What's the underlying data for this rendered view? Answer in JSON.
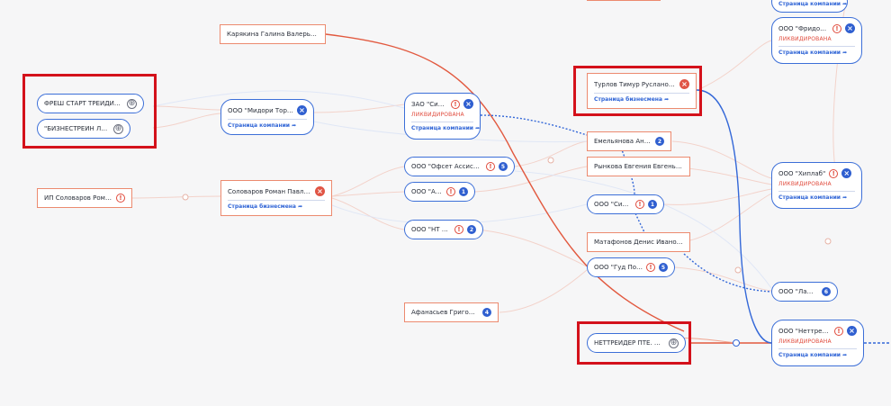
{
  "nodes": {
    "fresh_start": {
      "label": "ФРЕШ СТАРТ ТРЕЙДИНГ...",
      "icon": "globe-icon"
    },
    "biznestrain": {
      "label": "\"БИЗНЕСТРЕЙН ЛТД\"",
      "icon": "globe-icon"
    },
    "ip_solovarov": {
      "label": "ИП Соловаров Роман..."
    },
    "karyakina": {
      "label": "Карякина Галина Валерьевна"
    },
    "midori": {
      "label": "ООО \"Мидори Торедо\"",
      "link": "Страница компании"
    },
    "solovarov": {
      "label": "Соловаров Роман Павлович",
      "link": "Страница бизнесмена"
    },
    "zao_sigma": {
      "label": "ЗАО \"Сигма\"",
      "status": "ЛИКВИДИРОВАНА",
      "link": "Страница компании"
    },
    "offset": {
      "label": "ООО \"Офсет Ассистанс\"",
      "badge": "5"
    },
    "ak": {
      "label": "ООО \"АК -...",
      "badge": "1"
    },
    "nt_oil": {
      "label": "ООО \"НТ Ойл\"",
      "badge": "2"
    },
    "afanasiev": {
      "label": "Афанасьев Григорий...",
      "badge": "4"
    },
    "turlov": {
      "label": "Турлов Тимур Русланович",
      "link": "Страница бизнесмена"
    },
    "emelyanova": {
      "label": "Емельянова Анна...",
      "badge": "2"
    },
    "rynkova": {
      "label": "Рынкова Евгения Евгеньевна"
    },
    "ooo_sigma": {
      "label": "ООО \"Сигма\"",
      "badge": "1"
    },
    "matafonov": {
      "label": "Матафонов Денис Иванович"
    },
    "gud_poker": {
      "label": "ООО \"Гуд Покер\"",
      "badge": "5"
    },
    "nettreider_pte": {
      "label": "НЕТТРЕЙДЕР ПТЕ. ЛТД.",
      "icon": "globe-icon"
    },
    "top_partial": {
      "link": "Страница компании"
    },
    "fridom": {
      "label": "ООО \"Фридом РС\"",
      "status": "ЛИКВИДИРОВАНА",
      "link": "Страница компании"
    },
    "hiplab": {
      "label": "ООО \"Хиплаб\"",
      "status": "ЛИКВИДИРОВАНА",
      "link": "Страница компании"
    },
    "lama": {
      "label": "ООО \"Лама\"",
      "badge": "6"
    },
    "nettreider": {
      "label": "ООО \"Неттрейдер\"",
      "status": "ЛИКВИДИРОВАНА",
      "link": "Страница компании"
    }
  },
  "colors": {
    "company_border": "#3c6fd8",
    "person_border": "#ec8a6f",
    "accent_blue": "#2f5fd0",
    "alert_red": "#e04a3b",
    "highlight": "#d4111b"
  }
}
